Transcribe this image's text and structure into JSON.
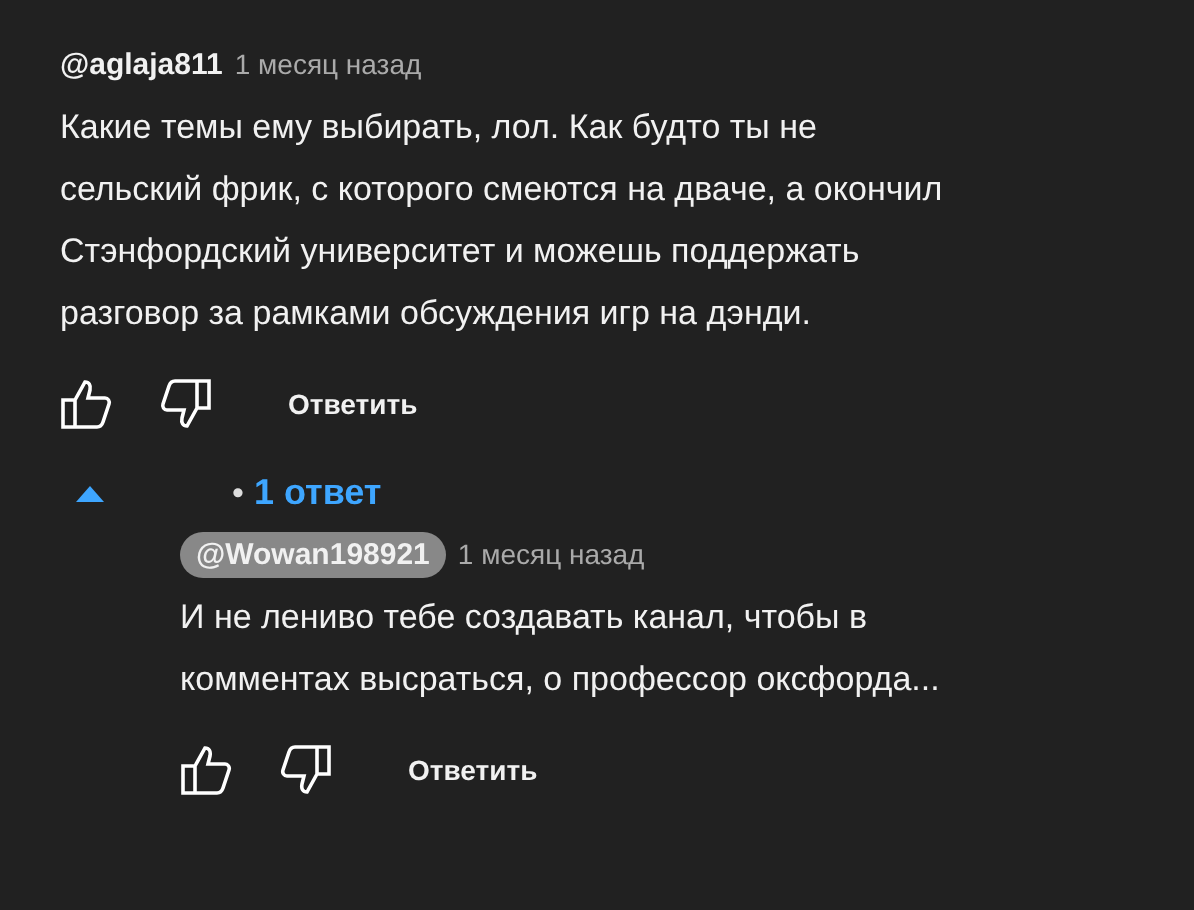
{
  "comment": {
    "author": "@aglaja811",
    "author_highlighted": false,
    "time": "1 месяц назад",
    "lines": [
      "Какие темы ему выбирать, лол. Как будто ты не",
      "сельский фрик, с которого смеются на дваче, а окончил",
      "Стэнфордский университет и можешь поддержать",
      "разговор за рамками обсуждения игр на дэнди."
    ],
    "reply_button": "Ответить"
  },
  "replies_toggle": {
    "expanded": true,
    "bullet": "•",
    "label": "1 ответ"
  },
  "replies": [
    {
      "author": "@Wowan198921",
      "author_highlighted": true,
      "time": "1 месяц назад",
      "lines": [
        "И не лениво тебе создавать канал, чтобы в",
        "комментах высраться, о профессор оксфорда..."
      ],
      "reply_button": "Ответить"
    }
  ]
}
